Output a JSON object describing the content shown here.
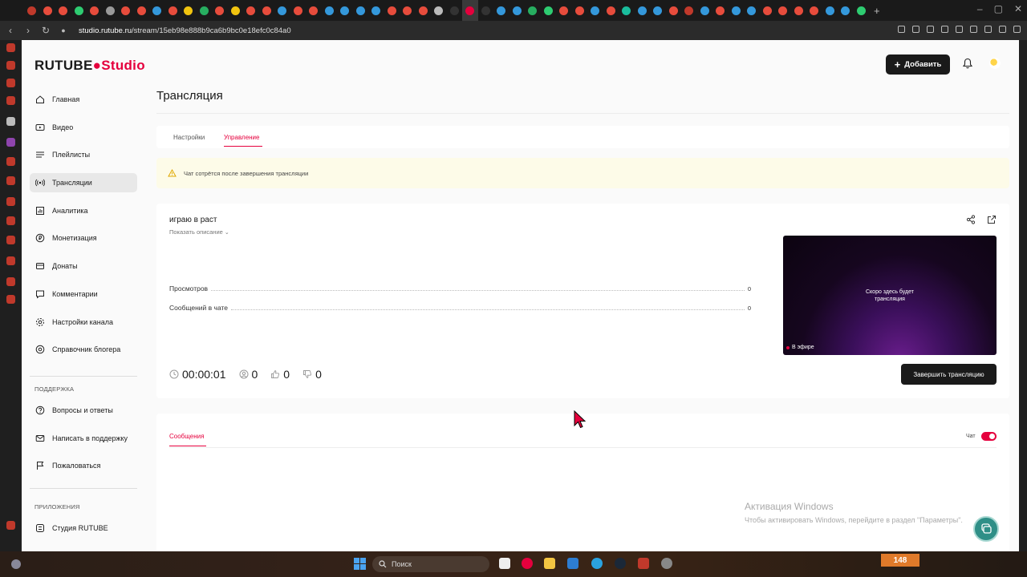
{
  "browser": {
    "url_host": "studio.rutube.ru",
    "url_path": "/stream/15eb98e888b9ca6b9bc0e18efc0c84a0",
    "window_controls": [
      "–",
      "▢",
      "✕"
    ]
  },
  "header": {
    "logo_rutube": "RUTUBE",
    "logo_studio": "Studio",
    "add_button": "Добавить"
  },
  "sidebar": {
    "items": [
      {
        "label": "Главная",
        "icon": "home-icon"
      },
      {
        "label": "Видео",
        "icon": "video-icon"
      },
      {
        "label": "Плейлисты",
        "icon": "playlist-icon"
      },
      {
        "label": "Трансляции",
        "icon": "broadcast-icon",
        "active": true
      },
      {
        "label": "Аналитика",
        "icon": "analytics-icon"
      },
      {
        "label": "Монетизация",
        "icon": "money-icon"
      },
      {
        "label": "Донаты",
        "icon": "donate-icon"
      },
      {
        "label": "Комментарии",
        "icon": "comment-icon"
      },
      {
        "label": "Настройки канала",
        "icon": "gear-icon"
      },
      {
        "label": "Справочник блогера",
        "icon": "help-circle-icon"
      }
    ],
    "support_heading": "ПОДДЕРЖКА",
    "support_items": [
      {
        "label": "Вопросы и ответы"
      },
      {
        "label": "Написать в поддержку"
      },
      {
        "label": "Пожаловаться"
      }
    ],
    "apps_heading": "ПРИЛОЖЕНИЯ",
    "apps_items": [
      {
        "label": "Студия RUTUBE"
      }
    ]
  },
  "main": {
    "title": "Трансляция",
    "tabs": [
      {
        "label": "Настройки"
      },
      {
        "label": "Управление",
        "active": true
      }
    ],
    "warning": "Чат сотрётся после завершения трансляции",
    "stream": {
      "title": "играю в раст",
      "show_description": "Показать описание",
      "stats": [
        {
          "label": "Просмотров",
          "value": "0"
        },
        {
          "label": "Сообщений в чате",
          "value": "0"
        }
      ],
      "duration": "00:00:01",
      "viewers": "0",
      "likes": "0",
      "dislikes": "0",
      "preview_text_line1": "Скоро здесь будет",
      "preview_text_line2": "трансляция",
      "live_badge": "В эфире",
      "end_button": "Завершить трансляцию"
    },
    "messages": {
      "tab_label": "Сообщения",
      "chat_label": "Чат",
      "chat_enabled": true
    }
  },
  "watermark": {
    "line1": "Активация Windows",
    "line2": "Чтобы активировать Windows, перейдите в раздел \"Параметры\"."
  },
  "taskbar": {
    "search_placeholder": "Поиск",
    "badge": "148"
  },
  "colors": {
    "accent": "#e5003d",
    "dark": "#1a1a1a",
    "warning_bg": "#fdfbe8",
    "fab": "#2f8f87"
  }
}
